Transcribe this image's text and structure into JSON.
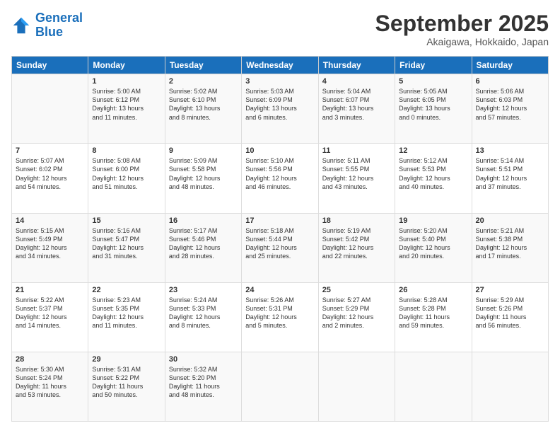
{
  "header": {
    "logo_line1": "General",
    "logo_line2": "Blue",
    "month": "September 2025",
    "location": "Akaigawa, Hokkaido, Japan"
  },
  "weekdays": [
    "Sunday",
    "Monday",
    "Tuesday",
    "Wednesday",
    "Thursday",
    "Friday",
    "Saturday"
  ],
  "weeks": [
    [
      {
        "day": "",
        "info": ""
      },
      {
        "day": "1",
        "info": "Sunrise: 5:00 AM\nSunset: 6:12 PM\nDaylight: 13 hours\nand 11 minutes."
      },
      {
        "day": "2",
        "info": "Sunrise: 5:02 AM\nSunset: 6:10 PM\nDaylight: 13 hours\nand 8 minutes."
      },
      {
        "day": "3",
        "info": "Sunrise: 5:03 AM\nSunset: 6:09 PM\nDaylight: 13 hours\nand 6 minutes."
      },
      {
        "day": "4",
        "info": "Sunrise: 5:04 AM\nSunset: 6:07 PM\nDaylight: 13 hours\nand 3 minutes."
      },
      {
        "day": "5",
        "info": "Sunrise: 5:05 AM\nSunset: 6:05 PM\nDaylight: 13 hours\nand 0 minutes."
      },
      {
        "day": "6",
        "info": "Sunrise: 5:06 AM\nSunset: 6:03 PM\nDaylight: 12 hours\nand 57 minutes."
      }
    ],
    [
      {
        "day": "7",
        "info": "Sunrise: 5:07 AM\nSunset: 6:02 PM\nDaylight: 12 hours\nand 54 minutes."
      },
      {
        "day": "8",
        "info": "Sunrise: 5:08 AM\nSunset: 6:00 PM\nDaylight: 12 hours\nand 51 minutes."
      },
      {
        "day": "9",
        "info": "Sunrise: 5:09 AM\nSunset: 5:58 PM\nDaylight: 12 hours\nand 48 minutes."
      },
      {
        "day": "10",
        "info": "Sunrise: 5:10 AM\nSunset: 5:56 PM\nDaylight: 12 hours\nand 46 minutes."
      },
      {
        "day": "11",
        "info": "Sunrise: 5:11 AM\nSunset: 5:55 PM\nDaylight: 12 hours\nand 43 minutes."
      },
      {
        "day": "12",
        "info": "Sunrise: 5:12 AM\nSunset: 5:53 PM\nDaylight: 12 hours\nand 40 minutes."
      },
      {
        "day": "13",
        "info": "Sunrise: 5:14 AM\nSunset: 5:51 PM\nDaylight: 12 hours\nand 37 minutes."
      }
    ],
    [
      {
        "day": "14",
        "info": "Sunrise: 5:15 AM\nSunset: 5:49 PM\nDaylight: 12 hours\nand 34 minutes."
      },
      {
        "day": "15",
        "info": "Sunrise: 5:16 AM\nSunset: 5:47 PM\nDaylight: 12 hours\nand 31 minutes."
      },
      {
        "day": "16",
        "info": "Sunrise: 5:17 AM\nSunset: 5:46 PM\nDaylight: 12 hours\nand 28 minutes."
      },
      {
        "day": "17",
        "info": "Sunrise: 5:18 AM\nSunset: 5:44 PM\nDaylight: 12 hours\nand 25 minutes."
      },
      {
        "day": "18",
        "info": "Sunrise: 5:19 AM\nSunset: 5:42 PM\nDaylight: 12 hours\nand 22 minutes."
      },
      {
        "day": "19",
        "info": "Sunrise: 5:20 AM\nSunset: 5:40 PM\nDaylight: 12 hours\nand 20 minutes."
      },
      {
        "day": "20",
        "info": "Sunrise: 5:21 AM\nSunset: 5:38 PM\nDaylight: 12 hours\nand 17 minutes."
      }
    ],
    [
      {
        "day": "21",
        "info": "Sunrise: 5:22 AM\nSunset: 5:37 PM\nDaylight: 12 hours\nand 14 minutes."
      },
      {
        "day": "22",
        "info": "Sunrise: 5:23 AM\nSunset: 5:35 PM\nDaylight: 12 hours\nand 11 minutes."
      },
      {
        "day": "23",
        "info": "Sunrise: 5:24 AM\nSunset: 5:33 PM\nDaylight: 12 hours\nand 8 minutes."
      },
      {
        "day": "24",
        "info": "Sunrise: 5:26 AM\nSunset: 5:31 PM\nDaylight: 12 hours\nand 5 minutes."
      },
      {
        "day": "25",
        "info": "Sunrise: 5:27 AM\nSunset: 5:29 PM\nDaylight: 12 hours\nand 2 minutes."
      },
      {
        "day": "26",
        "info": "Sunrise: 5:28 AM\nSunset: 5:28 PM\nDaylight: 11 hours\nand 59 minutes."
      },
      {
        "day": "27",
        "info": "Sunrise: 5:29 AM\nSunset: 5:26 PM\nDaylight: 11 hours\nand 56 minutes."
      }
    ],
    [
      {
        "day": "28",
        "info": "Sunrise: 5:30 AM\nSunset: 5:24 PM\nDaylight: 11 hours\nand 53 minutes."
      },
      {
        "day": "29",
        "info": "Sunrise: 5:31 AM\nSunset: 5:22 PM\nDaylight: 11 hours\nand 50 minutes."
      },
      {
        "day": "30",
        "info": "Sunrise: 5:32 AM\nSunset: 5:20 PM\nDaylight: 11 hours\nand 48 minutes."
      },
      {
        "day": "",
        "info": ""
      },
      {
        "day": "",
        "info": ""
      },
      {
        "day": "",
        "info": ""
      },
      {
        "day": "",
        "info": ""
      }
    ]
  ]
}
